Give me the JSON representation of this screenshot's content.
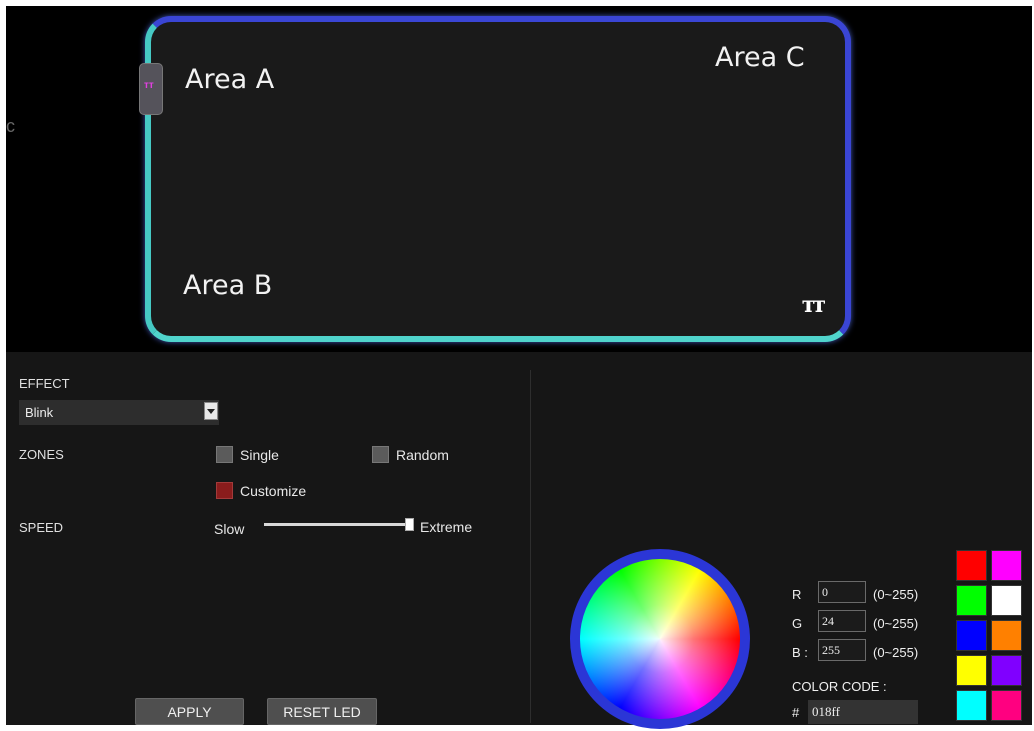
{
  "preview": {
    "area_a": "Area A",
    "area_b": "Area B",
    "area_c": "Area C",
    "stray_char": "c",
    "brand_logo": "tt-logo"
  },
  "effect": {
    "label": "EFFECT",
    "selected": "Blink"
  },
  "zones": {
    "label": "ZONES",
    "single": "Single",
    "random": "Random",
    "customize": "Customize",
    "checked": "customize"
  },
  "speed": {
    "label": "SPEED",
    "min_label": "Slow",
    "max_label": "Extreme",
    "level": 1.0
  },
  "buttons": {
    "apply": "APPLY",
    "reset": "RESET LED"
  },
  "color": {
    "r_label": "R",
    "g_label": "G",
    "b_label": "B :",
    "r": "0",
    "g": "24",
    "b": "255",
    "range": "(0~255)",
    "code_label": "COLOR CODE :",
    "hash": "#",
    "code": "018ff"
  },
  "swatches": [
    "#ff0000",
    "#ff00ff",
    "#00ff00",
    "#ffffff",
    "#0000ff",
    "#ff8000",
    "#ffff00",
    "#8000ff",
    "#00ffff",
    "#ff0080"
  ],
  "colors": {
    "accent_blue": "#3a45d4",
    "accent_teal": "#46c9c4",
    "panel_bg": "#161616"
  }
}
